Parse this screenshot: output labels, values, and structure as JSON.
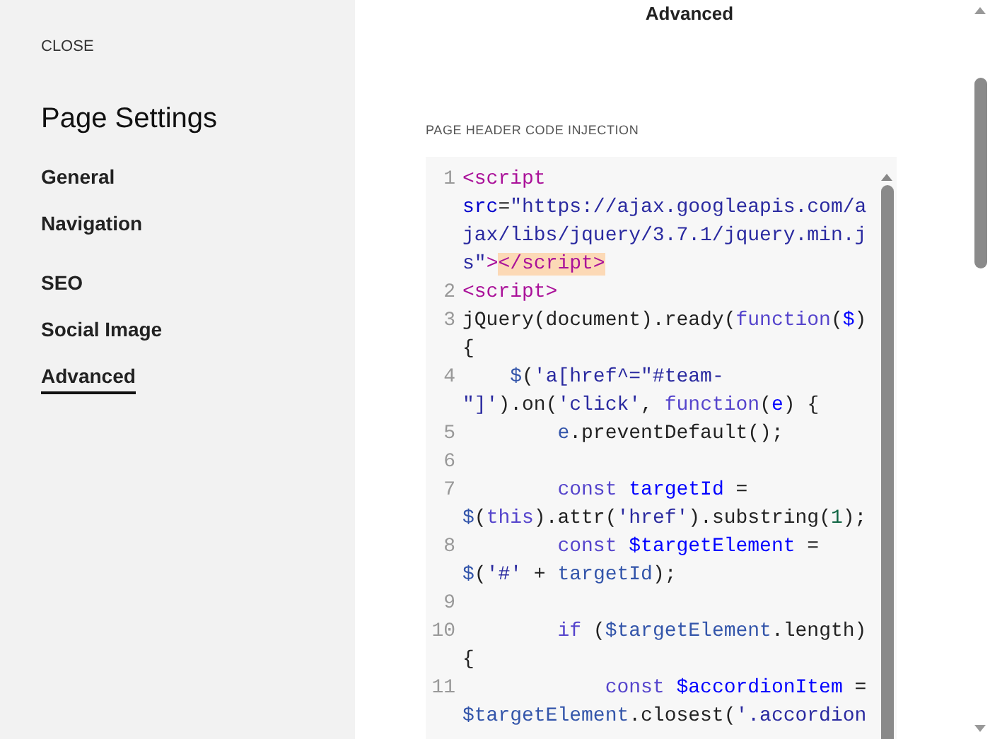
{
  "sidebar": {
    "close": "CLOSE",
    "title": "Page Settings",
    "groups": [
      [
        {
          "label": "General",
          "selected": false
        },
        {
          "label": "Navigation",
          "selected": false
        }
      ],
      [
        {
          "label": "SEO",
          "selected": false
        },
        {
          "label": "Social Image",
          "selected": false
        },
        {
          "label": "Advanced",
          "selected": true
        }
      ]
    ]
  },
  "panel": {
    "title": "Advanced",
    "field_label": "PAGE HEADER CODE INJECTION",
    "code_lines": [
      {
        "number": "1",
        "tokens": [
          {
            "kind": "tag",
            "text": "<script"
          },
          {
            "kind": "attr",
            "text": " src"
          },
          {
            "kind": "plain",
            "text": "="
          },
          {
            "kind": "string",
            "text": "\"https://ajax.googleapis.com/ajax/libs/jquery/3.7.1/jquery.min.js\""
          },
          {
            "kind": "tag",
            "text": ">"
          },
          {
            "kind": "matched-tag",
            "text": "</script>"
          }
        ]
      },
      {
        "number": "2",
        "tokens": [
          {
            "kind": "tag",
            "text": "<script>"
          }
        ]
      },
      {
        "number": "3",
        "tokens": [
          {
            "kind": "plain",
            "text": "jQuery(document).ready("
          },
          {
            "kind": "keyword",
            "text": "function"
          },
          {
            "kind": "plain",
            "text": "("
          },
          {
            "kind": "def",
            "text": "$"
          },
          {
            "kind": "plain",
            "text": ") {"
          }
        ]
      },
      {
        "number": "4",
        "tokens": [
          {
            "kind": "variable",
            "text": "    $"
          },
          {
            "kind": "plain",
            "text": "("
          },
          {
            "kind": "string",
            "text": "'a[href^=\"#team-\"]'"
          },
          {
            "kind": "plain",
            "text": ").on("
          },
          {
            "kind": "string",
            "text": "'click'"
          },
          {
            "kind": "plain",
            "text": ", "
          },
          {
            "kind": "keyword",
            "text": "function"
          },
          {
            "kind": "plain",
            "text": "("
          },
          {
            "kind": "def",
            "text": "e"
          },
          {
            "kind": "plain",
            "text": ") {"
          }
        ]
      },
      {
        "number": "5",
        "tokens": [
          {
            "kind": "variable",
            "text": "        e"
          },
          {
            "kind": "plain",
            "text": ".preventDefault();"
          }
        ]
      },
      {
        "number": "6"
      },
      {
        "number": "7",
        "tokens": [
          {
            "kind": "keyword",
            "text": "        const"
          },
          {
            "kind": "def",
            "text": " targetId"
          },
          {
            "kind": "plain",
            "text": " = "
          },
          {
            "kind": "variable",
            "text": "$"
          },
          {
            "kind": "plain",
            "text": "("
          },
          {
            "kind": "keyword",
            "text": "this"
          },
          {
            "kind": "plain",
            "text": ").attr("
          },
          {
            "kind": "string",
            "text": "'href'"
          },
          {
            "kind": "plain",
            "text": ").substring("
          },
          {
            "kind": "number",
            "text": "1"
          },
          {
            "kind": "plain",
            "text": ");"
          }
        ]
      },
      {
        "number": "8",
        "tokens": [
          {
            "kind": "keyword",
            "text": "        const"
          },
          {
            "kind": "def",
            "text": " $targetElement"
          },
          {
            "kind": "plain",
            "text": " = "
          },
          {
            "kind": "variable",
            "text": "$"
          },
          {
            "kind": "plain",
            "text": "("
          },
          {
            "kind": "string",
            "text": "'#'"
          },
          {
            "kind": "plain",
            "text": " + "
          },
          {
            "kind": "variable",
            "text": "targetId"
          },
          {
            "kind": "plain",
            "text": ");"
          }
        ]
      },
      {
        "number": "9"
      },
      {
        "number": "10",
        "tokens": [
          {
            "kind": "keyword",
            "text": "        if"
          },
          {
            "kind": "plain",
            "text": " ("
          },
          {
            "kind": "variable",
            "text": "$targetElement"
          },
          {
            "kind": "plain",
            "text": ".length) {"
          }
        ]
      },
      {
        "number": "11",
        "tokens": [
          {
            "kind": "keyword",
            "text": "            const"
          },
          {
            "kind": "def",
            "text": " $accordionItem"
          },
          {
            "kind": "plain",
            "text": " = "
          },
          {
            "kind": "variable",
            "text": "$targetElement"
          },
          {
            "kind": "plain",
            "text": ".closest("
          },
          {
            "kind": "string",
            "text": "'.accordion"
          }
        ]
      }
    ]
  }
}
